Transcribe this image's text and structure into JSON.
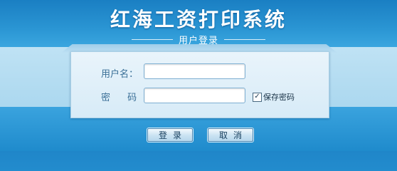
{
  "header": {
    "title": "红海工资打印系统",
    "subtitle": "用户登录"
  },
  "form": {
    "username_label": "用户名：",
    "username_value": "",
    "password_label": "密 码：",
    "password_value": "",
    "remember_label": "保存密码",
    "remember_checked": true,
    "remember_check_glyph": "✓"
  },
  "buttons": {
    "login_label": "登录",
    "cancel_label": "取消"
  },
  "colors": {
    "background_blue": "#2a97d6",
    "panel": "#e2f0f9",
    "label_text": "#3a6f97"
  }
}
